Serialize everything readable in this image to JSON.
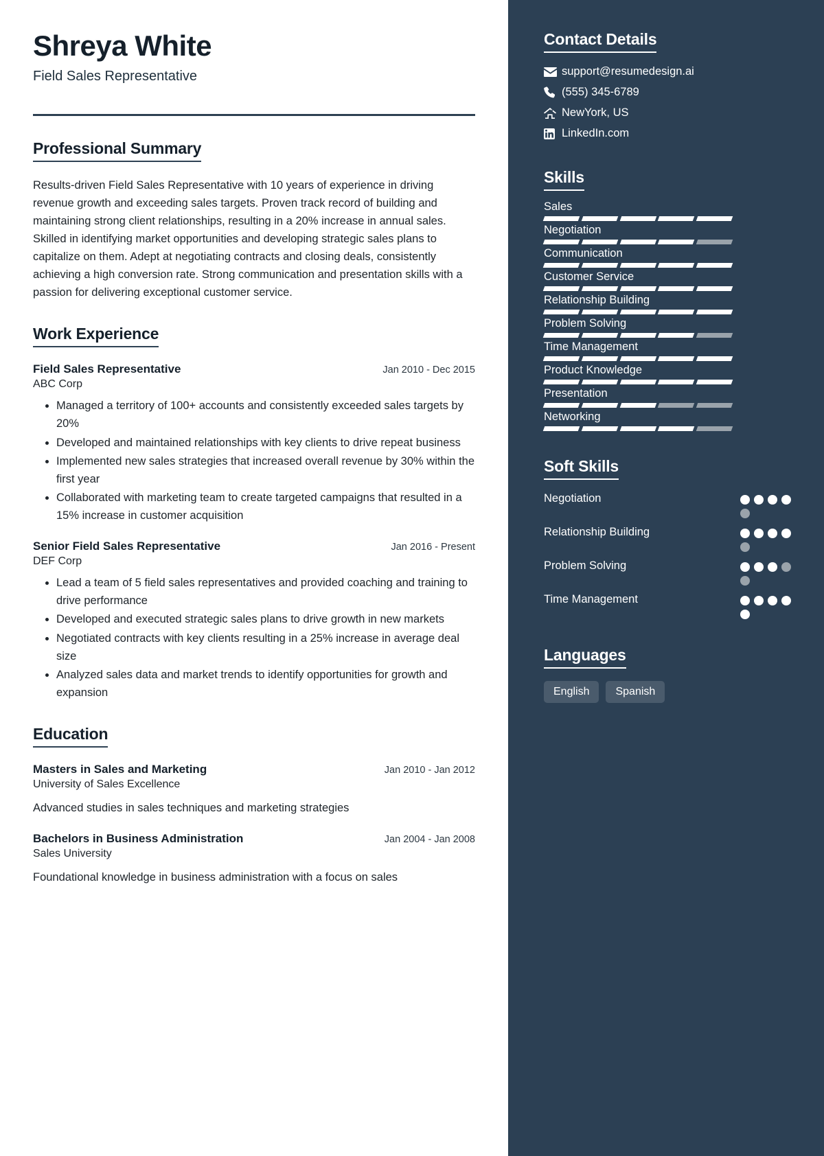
{
  "header": {
    "name": "Shreya White",
    "title": "Field Sales Representative"
  },
  "summary": {
    "heading": "Professional Summary",
    "text": "Results-driven Field Sales Representative with 10 years of experience in driving revenue growth and exceeding sales targets. Proven track record of building and maintaining strong client relationships, resulting in a 20% increase in annual sales. Skilled in identifying market opportunities and developing strategic sales plans to capitalize on them. Adept at negotiating contracts and closing deals, consistently achieving a high conversion rate. Strong communication and presentation skills with a passion for delivering exceptional customer service."
  },
  "work": {
    "heading": "Work Experience",
    "entries": [
      {
        "role": "Field Sales Representative",
        "date": "Jan 2010 - Dec 2015",
        "org": "ABC Corp",
        "bullets": [
          "Managed a territory of 100+ accounts and consistently exceeded sales targets by 20%",
          "Developed and maintained relationships with key clients to drive repeat business",
          "Implemented new sales strategies that increased overall revenue by 30% within the first year",
          "Collaborated with marketing team to create targeted campaigns that resulted in a 15% increase in customer acquisition"
        ]
      },
      {
        "role": "Senior Field Sales Representative",
        "date": "Jan 2016 - Present",
        "org": "DEF Corp",
        "bullets": [
          "Lead a team of 5 field sales representatives and provided coaching and training to drive performance",
          "Developed and executed strategic sales plans to drive growth in new markets",
          "Negotiated contracts with key clients resulting in a 25% increase in average deal size",
          "Analyzed sales data and market trends to identify opportunities for growth and expansion"
        ]
      }
    ]
  },
  "education": {
    "heading": "Education",
    "entries": [
      {
        "degree": "Masters in Sales and Marketing",
        "date": "Jan 2010 - Jan 2012",
        "school": "University of Sales Excellence",
        "description": "Advanced studies in sales techniques and marketing strategies"
      },
      {
        "degree": "Bachelors in Business Administration",
        "date": "Jan 2004 - Jan 2008",
        "school": "Sales University",
        "description": "Foundational knowledge in business administration with a focus on sales"
      }
    ]
  },
  "contact": {
    "heading": "Contact Details",
    "items": [
      {
        "icon": "email-icon",
        "value": "support@resumedesign.ai"
      },
      {
        "icon": "phone-icon",
        "value": "(555) 345-6789"
      },
      {
        "icon": "home-icon",
        "value": "NewYork, US"
      },
      {
        "icon": "linkedin-icon",
        "value": "LinkedIn.com"
      }
    ]
  },
  "skills": {
    "heading": "Skills",
    "segments_total": 5,
    "items": [
      {
        "name": "Sales",
        "filled": 5
      },
      {
        "name": "Negotiation",
        "filled": 4
      },
      {
        "name": "Communication",
        "filled": 5
      },
      {
        "name": "Customer Service",
        "filled": 5
      },
      {
        "name": "Relationship Building",
        "filled": 5
      },
      {
        "name": "Problem Solving",
        "filled": 4
      },
      {
        "name": "Time Management",
        "filled": 5
      },
      {
        "name": "Product Knowledge",
        "filled": 5
      },
      {
        "name": "Presentation",
        "filled": 3
      },
      {
        "name": "Networking",
        "filled": 4
      }
    ]
  },
  "soft_skills": {
    "heading": "Soft Skills",
    "dots_total": 5,
    "items": [
      {
        "name": "Negotiation",
        "filled": 4
      },
      {
        "name": "Relationship Building",
        "filled": 4
      },
      {
        "name": "Problem Solving",
        "filled": 3
      },
      {
        "name": "Time Management",
        "filled": 5
      }
    ]
  },
  "languages": {
    "heading": "Languages",
    "items": [
      "English",
      "Spanish"
    ]
  },
  "colors": {
    "sidebar_bg": "#2c4054",
    "accent_rule": "#2e4152",
    "chip_bg": "#4a5b6c",
    "muted": "#9aa3ab"
  }
}
